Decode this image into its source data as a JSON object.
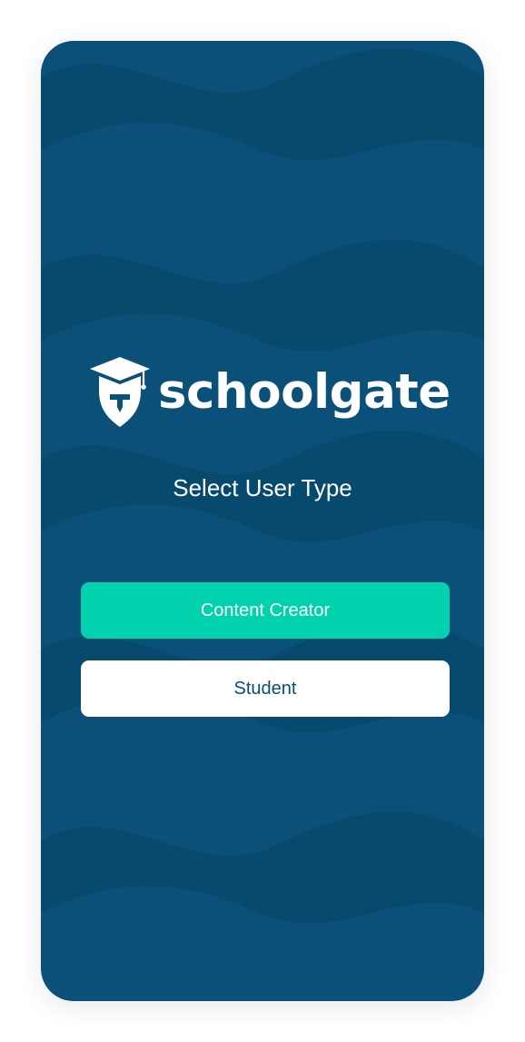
{
  "brand": {
    "name": "schoolgate",
    "logo_icon": "graduation-cap-pen-icon"
  },
  "screen": {
    "title": "Select User Type"
  },
  "actions": {
    "content_creator_label": "Content Creator",
    "student_label": "Student"
  },
  "colors": {
    "background": "#0a5078",
    "primary_button": "#00d2ad",
    "secondary_button": "#ffffff",
    "secondary_button_text": "#0a4d73"
  }
}
